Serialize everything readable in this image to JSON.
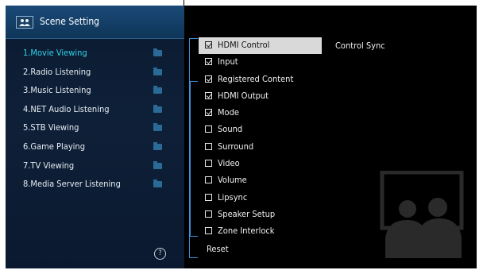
{
  "header": {
    "title": "Scene Setting",
    "icon": "scene-icon"
  },
  "menu": {
    "items": [
      {
        "label": "1.Movie Viewing",
        "active": true
      },
      {
        "label": "2.Radio Listening",
        "active": false
      },
      {
        "label": "3.Music Listening",
        "active": false
      },
      {
        "label": "4.NET Audio Listening",
        "active": false
      },
      {
        "label": "5.STB Viewing",
        "active": false
      },
      {
        "label": "6.Game Playing",
        "active": false
      },
      {
        "label": "7.TV Viewing",
        "active": false
      },
      {
        "label": "8.Media Server Listening",
        "active": false
      }
    ],
    "help_icon": "?"
  },
  "options": {
    "items": [
      {
        "label": "HDMI Control",
        "checked": true,
        "selected": true
      },
      {
        "label": "Input",
        "checked": true,
        "selected": false
      },
      {
        "label": "Registered Content",
        "checked": true,
        "selected": false
      },
      {
        "label": "HDMI Output",
        "checked": true,
        "selected": false
      },
      {
        "label": "Mode",
        "checked": true,
        "selected": false
      },
      {
        "label": "Sound",
        "checked": false,
        "selected": false
      },
      {
        "label": "Surround",
        "checked": false,
        "selected": false
      },
      {
        "label": "Video",
        "checked": false,
        "selected": false
      },
      {
        "label": "Volume",
        "checked": false,
        "selected": false
      },
      {
        "label": "Lipsync",
        "checked": false,
        "selected": false
      },
      {
        "label": "Speaker Setup",
        "checked": false,
        "selected": false
      },
      {
        "label": "Zone Interlock",
        "checked": false,
        "selected": false
      }
    ],
    "reset_label": "Reset"
  },
  "description": {
    "text": "Control Sync"
  },
  "colors": {
    "accent": "#2fd3ea",
    "bracket": "#3a8fd8",
    "selected_bg": "#d9d9d9"
  }
}
